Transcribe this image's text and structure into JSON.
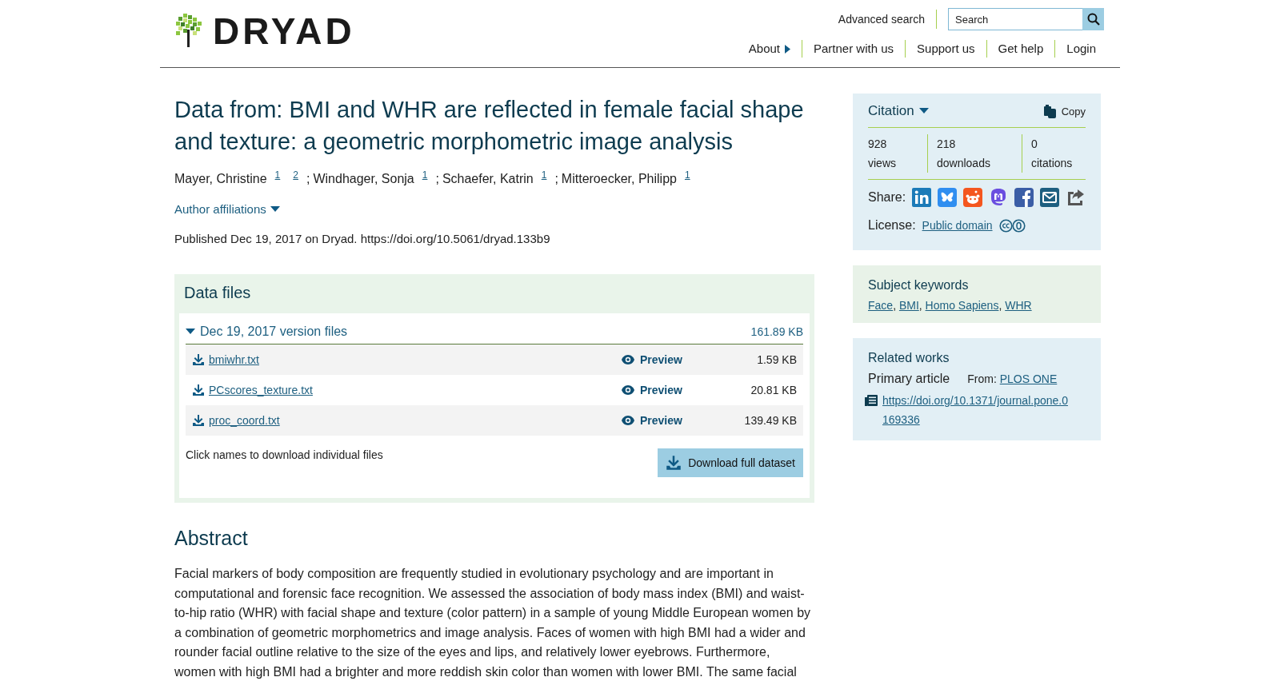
{
  "header": {
    "logo": "DRYAD",
    "advanced_search": "Advanced search",
    "search": {
      "placeholder": "Search"
    },
    "nav": [
      {
        "label": "About",
        "kind": "menu"
      },
      {
        "label": "Partner with us",
        "kind": "link"
      },
      {
        "label": "Support us",
        "kind": "link"
      },
      {
        "label": "Get help",
        "kind": "link"
      },
      {
        "label": "Login",
        "kind": "link"
      }
    ]
  },
  "title": "Data from: BMI and WHR are reflected in female facial shape and texture: a geometric morphometric image analysis",
  "authors": {
    "separator": ";",
    "items": [
      {
        "name": "Mayer, Christine",
        "affiliations": [
          "1",
          "2"
        ]
      },
      {
        "name": "Windhager, Sonja",
        "affiliations": [
          "1"
        ]
      },
      {
        "name": "Schaefer, Katrin",
        "affiliations": [
          "1"
        ]
      },
      {
        "name": "Mitteroecker, Philipp",
        "affiliations": [
          "1"
        ]
      }
    ]
  },
  "author_affiliations": {
    "label": "Author affiliations",
    "expanded": false
  },
  "published": "Published Dec 19, 2017 on Dryad. https://doi.org/10.5061/dryad.133b9",
  "data_files": {
    "title": "Data files",
    "version": {
      "label": "Dec 19, 2017 version files",
      "size": "161.89 KB",
      "expanded": true
    },
    "files": [
      {
        "name": "bmiwhr.txt",
        "preview": "Preview",
        "size": "1.59 KB"
      },
      {
        "name": "PCscores_texture.txt",
        "preview": "Preview",
        "size": "20.81 KB"
      },
      {
        "name": "proc_coord.txt",
        "preview": "Preview",
        "size": "139.49 KB"
      }
    ],
    "hint": "Click names to download individual files",
    "download_button": "Download full dataset"
  },
  "abstract": {
    "title": "Abstract",
    "text": "Facial markers of body composition are frequently studied in evolutionary psychology and are important in computational and forensic face recognition. We assessed the association of body mass index (BMI) and waist-to-hip ratio (WHR) with facial shape and texture (color pattern) in a sample of young Middle European women by a combination of geometric morphometrics and image analysis. Faces of women with high BMI had a wider and rounder facial outline relative to the size of the eyes and lips, and relatively lower eyebrows. Furthermore, women with high BMI had a brighter and more reddish skin color than women with lower BMI. The same facial"
  },
  "citation": {
    "title": "Citation",
    "copy": "Copy",
    "metrics": [
      {
        "value": "928",
        "label": "views"
      },
      {
        "value": "218",
        "label": "downloads"
      },
      {
        "value": "0",
        "label": "citations"
      }
    ],
    "share_label": "Share:",
    "share": [
      {
        "kind": "linkedin"
      },
      {
        "kind": "bluesky"
      },
      {
        "kind": "reddit"
      },
      {
        "kind": "mastodon"
      },
      {
        "kind": "facebook"
      },
      {
        "kind": "email"
      },
      {
        "kind": "share"
      }
    ],
    "license_label": "License:",
    "license": "Public domain"
  },
  "keywords": {
    "title": "Subject keywords",
    "separator": ",",
    "items": [
      "Face",
      "BMI",
      "Homo Sapiens",
      "WHR"
    ]
  },
  "related": {
    "title": "Related works",
    "type": "Primary article",
    "from_label": "From:",
    "source": "PLOS ONE",
    "doi": "https://doi.org/10.1371/journal.pone.0169336"
  }
}
